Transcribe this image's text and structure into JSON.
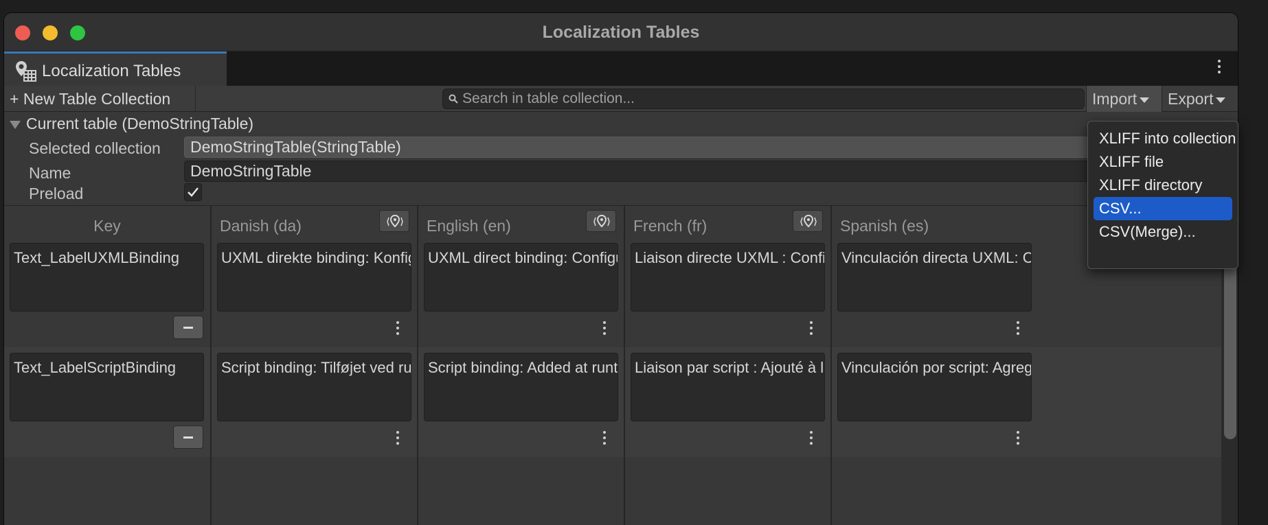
{
  "window": {
    "title": "Localization Tables"
  },
  "tab": {
    "label": "Localization Tables",
    "icon": "localization-table-icon"
  },
  "toolbar": {
    "new_label": "+ New Table Collection",
    "search_placeholder": "Search in table collection...",
    "import_label": "Import",
    "export_label": "Export"
  },
  "current_table": {
    "header": "Current table (DemoStringTable)",
    "selected_collection_label": "Selected collection",
    "selected_collection_value": "DemoStringTable(StringTable)",
    "name_label": "Name",
    "name_value": "DemoStringTable",
    "preload_label": "Preload",
    "preload_checked": true
  },
  "columns": [
    {
      "header": "Key"
    },
    {
      "header": "Danish (da)"
    },
    {
      "header": "English (en)"
    },
    {
      "header": "French (fr)"
    },
    {
      "header": "Spanish (es)"
    }
  ],
  "rows": [
    {
      "key": "Text_LabelUXMLBinding",
      "values": [
        "UXML direkte binding: Konfig",
        "UXML direct binding: Configu",
        "Liaison directe UXML : Confi",
        "Vinculación directa UXML: C"
      ]
    },
    {
      "key": "Text_LabelScriptBinding",
      "values": [
        "Script binding: Tilføjet ved ru",
        "Script binding: Added at runt",
        "Liaison par script : Ajouté à l'",
        "Vinculación por script: Agreg"
      ]
    }
  ],
  "import_menu": {
    "items": [
      "XLIFF into collection",
      "XLIFF file",
      "XLIFF directory",
      "CSV...",
      "CSV(Merge)..."
    ],
    "highlighted_index": 3
  },
  "colors": {
    "accent": "#1d5cc8",
    "tab_underline": "#3a79bb",
    "window_bg": "#383838"
  }
}
